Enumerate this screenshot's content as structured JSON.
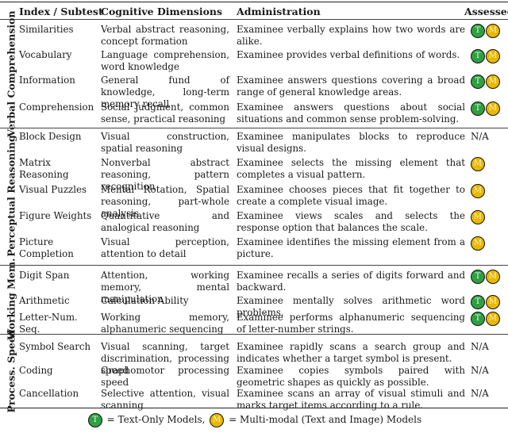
{
  "header": {
    "col1": "Index / Subtest",
    "col2": "Cognitive Dimensions",
    "col3": "Administration",
    "col4": "Assessed"
  },
  "groups": [
    {
      "label": "Verbal Comprehension",
      "rows": [
        {
          "subtest": "Similarities",
          "dimensions": "Verbal abstract reasoning, concept formation",
          "administration": "Examinee verbally explains how two words are alike.",
          "assessed": [
            "T",
            "M"
          ]
        },
        {
          "subtest": "Vocabulary",
          "dimensions": "Language comprehension, word knowledge",
          "administration": "Examinee provides verbal definitions of words.",
          "assessed": [
            "T",
            "M"
          ]
        },
        {
          "subtest": "Information",
          "dimensions": "General fund of knowledge, long-term memory recall",
          "administration": "Examinee answers questions covering a broad range of general knowledge areas.",
          "assessed": [
            "T",
            "M"
          ]
        },
        {
          "subtest": "Comprehension",
          "dimensions": "Social judgment, common sense, practical reasoning",
          "administration": "Examinee answers questions about social situations and common sense problem-solving.",
          "assessed": [
            "T",
            "M"
          ]
        }
      ]
    },
    {
      "label": "Perceptual Reasoning",
      "rows": [
        {
          "subtest": "Block Design",
          "dimensions": "Visual construction, spatial reasoning",
          "administration": "Examinee manipulates blocks to reproduce visual designs.",
          "assessed": "N/A"
        },
        {
          "subtest": "Matrix Reasoning",
          "dimensions": "Nonverbal abstract reasoning, pattern recognition",
          "administration": "Examinee selects the missing element that completes a visual pattern.",
          "assessed": [
            "M"
          ]
        },
        {
          "subtest": "Visual Puzzles",
          "dimensions": "Mental Rotation, Spatial reasoning, part-whole analysis",
          "administration": "Examinee chooses pieces that fit together to create a complete visual image.",
          "assessed": [
            "M"
          ]
        },
        {
          "subtest": "Figure Weights",
          "dimensions": "Quantitative and analogical reasoning",
          "administration": "Examinee views scales and selects the response option that balances the scale.",
          "assessed": [
            "M"
          ]
        },
        {
          "subtest": "Picture Completion",
          "dimensions": "Visual perception, attention to detail",
          "administration": "Examinee identifies the missing element from a picture.",
          "assessed": [
            "M"
          ]
        }
      ]
    },
    {
      "label": "Working Mem.",
      "rows": [
        {
          "subtest": "Digit Span",
          "dimensions": "Attention, working memory, mental manipulation",
          "administration": "Examinee recalls a series of digits forward and backward.",
          "assessed": [
            "T",
            "M"
          ]
        },
        {
          "subtest": "Arithmetic",
          "dimensions": "Calculation Ability",
          "administration": "Examinee mentally solves arithmetic word problems.",
          "assessed": [
            "T",
            "M"
          ]
        },
        {
          "subtest": "Letter-Num. Seq.",
          "dimensions": "Working memory, alphanumeric sequencing",
          "administration": "Examinee performs alphanumeric sequencing of letter-number strings.",
          "assessed": [
            "T",
            "M"
          ]
        }
      ]
    },
    {
      "label": "Process. Speed",
      "rows": [
        {
          "subtest": "Symbol Search",
          "dimensions": "Visual scanning, target discrimination, processing speed",
          "administration": "Examinee rapidly scans a search group and indicates whether a target symbol is present.",
          "assessed": "N/A"
        },
        {
          "subtest": "Coding",
          "dimensions": "Graphomotor processing speed",
          "administration": "Examinee copies symbols paired with geometric shapes as quickly as possible.",
          "assessed": "N/A"
        },
        {
          "subtest": "Cancellation",
          "dimensions": "Selective attention, visual scanning",
          "administration": "Examinee scans an array of visual stimuli and marks target items according to a rule.",
          "assessed": "N/A"
        }
      ]
    }
  ],
  "legend": {
    "t_badge": "T",
    "t_text": "= Text-Only Models,",
    "m_badge": "M",
    "m_text": "= Multi-modal (Text and Image) Models"
  },
  "colors": {
    "text_only_badge": "#2ea043",
    "multimodal_badge": "#e8b800"
  }
}
